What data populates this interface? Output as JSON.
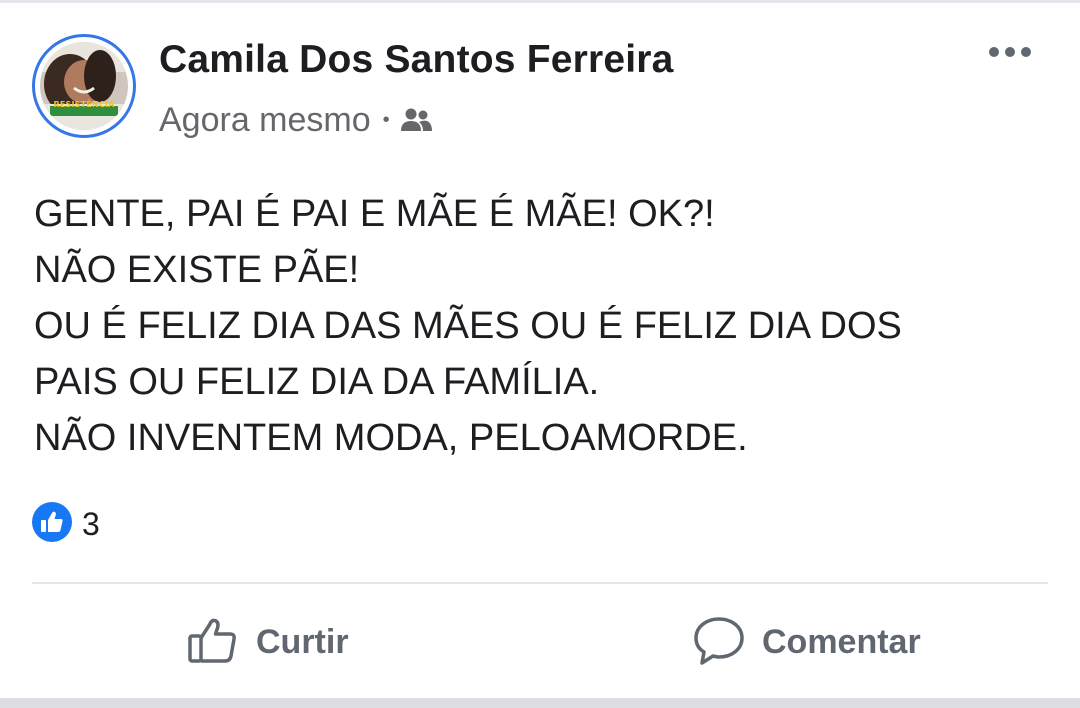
{
  "post": {
    "author_name": "Camila Dos Santos Ferreira",
    "timestamp": "Agora mesmo",
    "separator": "•",
    "audience_icon": "friends-icon",
    "avatar_badge": "RESISTÊNCIA",
    "more_icon": "more-dots-icon",
    "text_lines": [
      "GENTE, PAI É PAI E MÃE É MÃE! OK?!",
      "NÃO EXISTE PÃE!",
      "OU É FELIZ DIA DAS MÃES OU É FELIZ DIA DOS",
      "PAIS OU FELIZ DIA DA FAMÍLIA.",
      "NÃO INVENTEM MODA, PELOAMORDE."
    ],
    "reactions": {
      "icon": "like-reaction-icon",
      "count": "3"
    }
  },
  "actions": {
    "like_label": "Curtir",
    "comment_label": "Comentar"
  },
  "colors": {
    "accent": "#1877f2",
    "text": "#1c1e21",
    "secondary_text": "#65676b",
    "action_text": "#606770",
    "divider": "#e4e6eb"
  }
}
